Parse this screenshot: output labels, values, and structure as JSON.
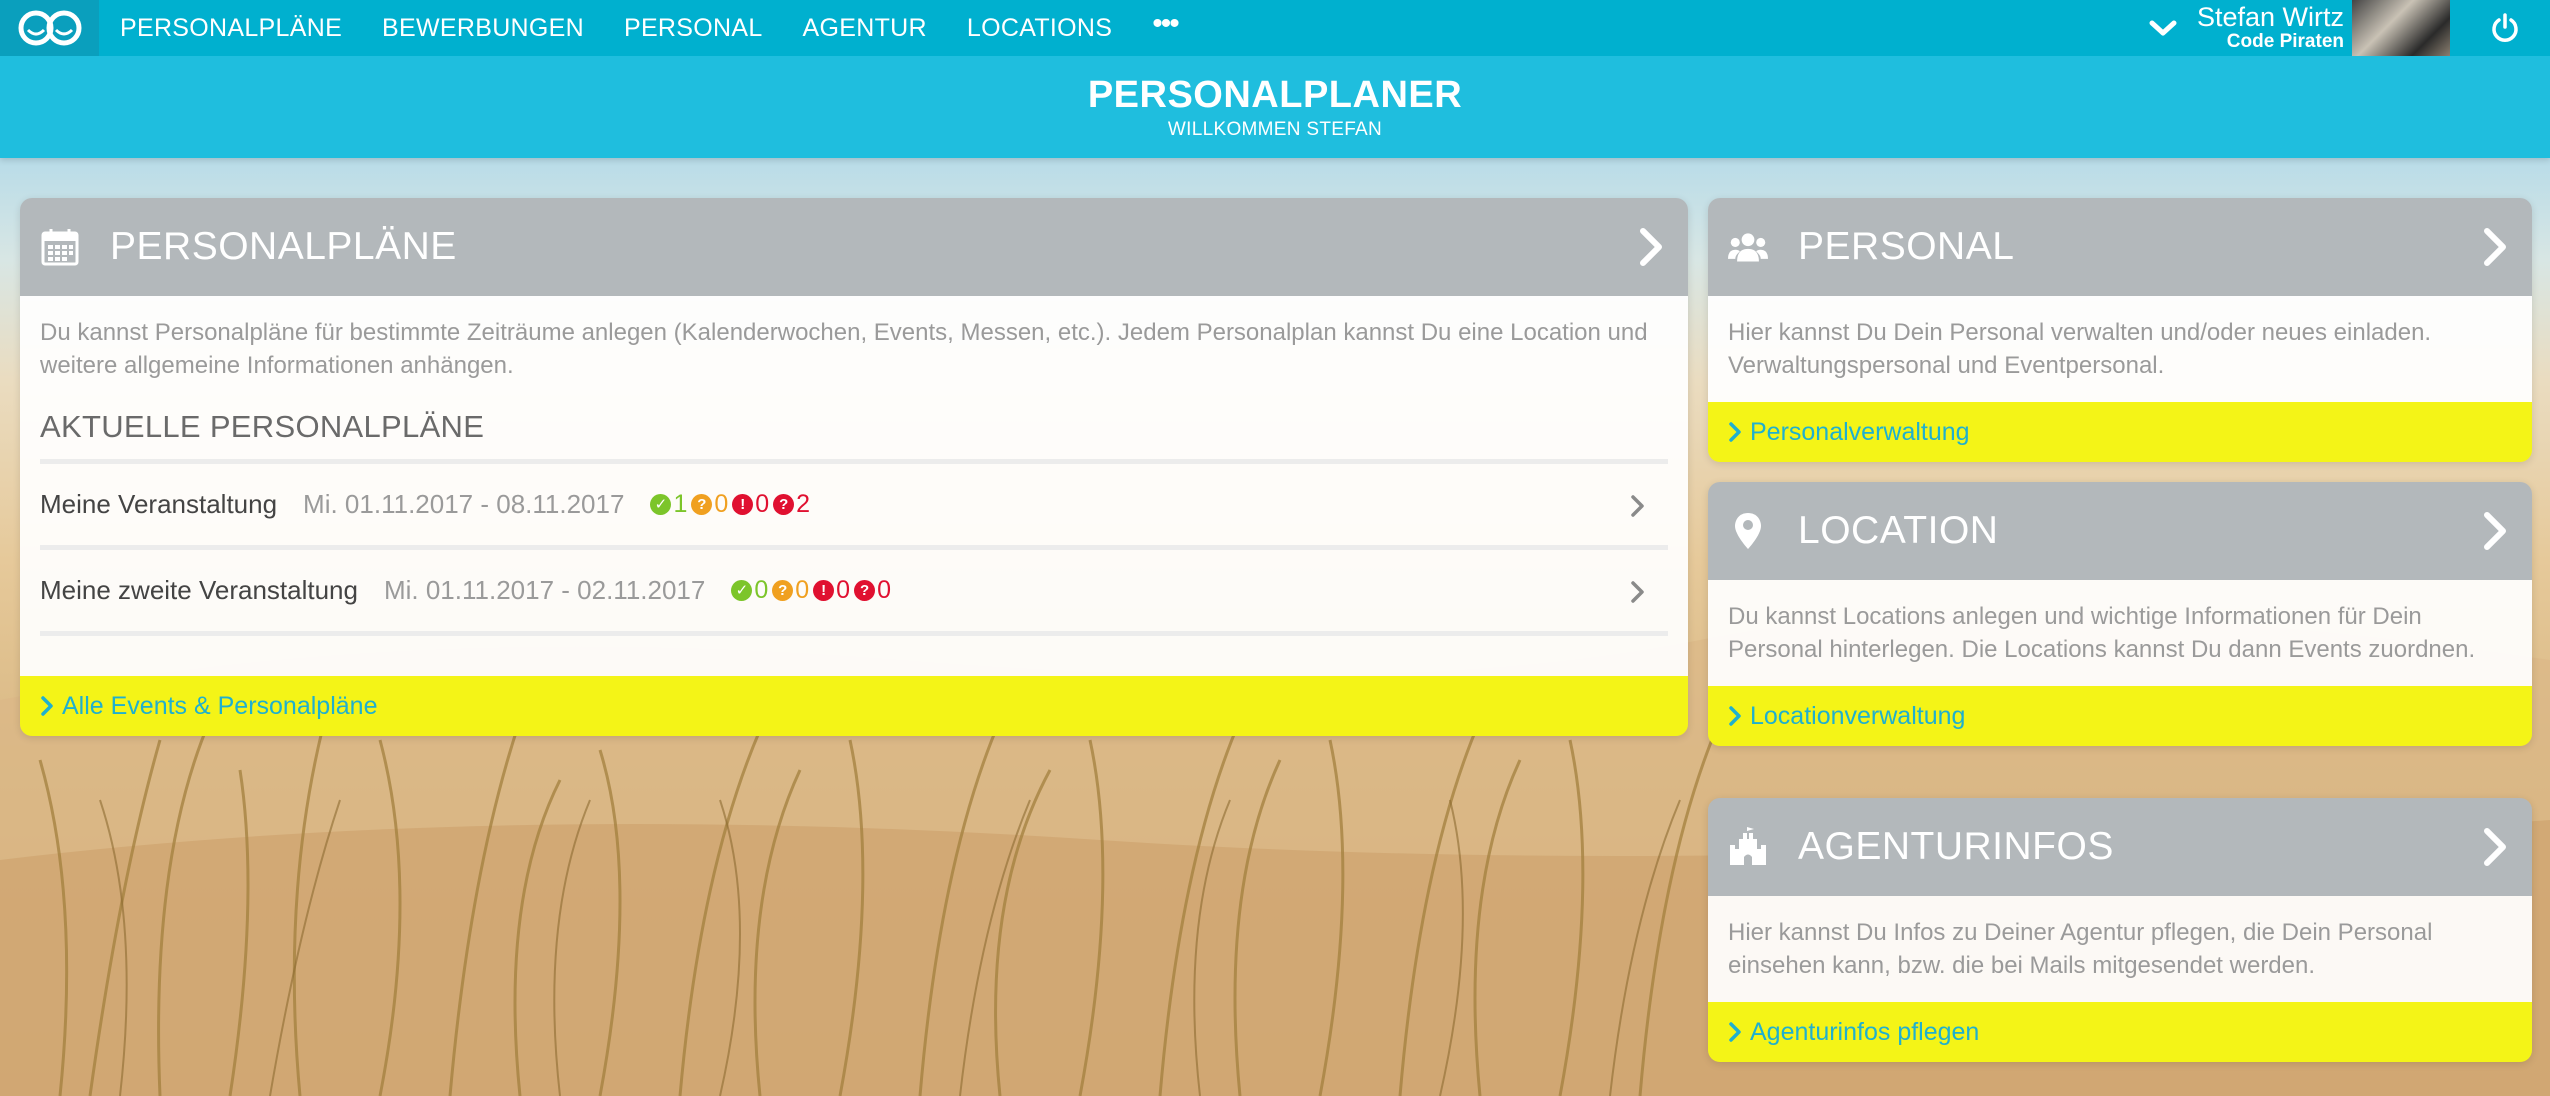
{
  "nav": {
    "items": [
      {
        "label": "PERSONALPLÄNE"
      },
      {
        "label": "BEWERBUNGEN"
      },
      {
        "label": "PERSONAL"
      },
      {
        "label": "AGENTUR"
      },
      {
        "label": "LOCATIONS"
      }
    ],
    "more": "•••",
    "user_name": "Stefan Wirtz",
    "user_company": "Code Piraten"
  },
  "header": {
    "title": "PERSONALPLANER",
    "subtitle": "WILLKOMMEN STEFAN"
  },
  "plans_card": {
    "title": "PERSONALPLÄNE",
    "icon": "calendar-icon",
    "description": "Du kannst Personalpläne für bestimmte Zeiträume anlegen (Kalenderwochen, Events, Messen, etc.). Jedem Personalplan kannst Du eine Location und weitere allgemeine Informationen anhängen.",
    "subtitle": "AKTUELLE PERSONALPLÄNE",
    "rows": [
      {
        "name": "Meine Veranstaltung",
        "date": "Mi. 01.11.2017 - 08.11.2017",
        "confirmed": "1",
        "pending": "0",
        "declined": "0",
        "open": "2"
      },
      {
        "name": "Meine zweite Veranstaltung",
        "date": "Mi. 01.11.2017 - 02.11.2017",
        "confirmed": "0",
        "pending": "0",
        "declined": "0",
        "open": "0"
      }
    ],
    "footer_link": "Alle Events & Personalpläne"
  },
  "personal_card": {
    "title": "PERSONAL",
    "icon": "users-icon",
    "description": "Hier kannst Du Dein Personal verwalten und/oder neues einladen. Verwaltungspersonal und Eventpersonal.",
    "footer_link": "Personalverwaltung"
  },
  "location_card": {
    "title": "LOCATION",
    "icon": "map-marker-icon",
    "description": "Du kannst Locations anlegen und wichtige Informationen für Dein Personal hinterlegen. Die Locations kannst Du dann Events zuordnen.",
    "footer_link": "Locationverwaltung"
  },
  "agency_card": {
    "title": "AGENTURINFOS",
    "icon": "castle-icon",
    "description": "Hier kannst Du Infos zu Deiner Agentur pflegen, die Dein Personal einsehen kann, bzw. die bei Mails mitgesendet werden.",
    "footer_link": "Agenturinfos pflegen"
  },
  "colors": {
    "nav_bg": "#00b0cf",
    "header_bg": "#1fbede",
    "card_head": "#b3b8bb",
    "footer_bg": "#f4f417",
    "link": "#1fb0cf",
    "status_confirmed": "#7cc52a",
    "status_pending": "#f0a020",
    "status_declined": "#e01030",
    "status_open": "#e01030"
  }
}
